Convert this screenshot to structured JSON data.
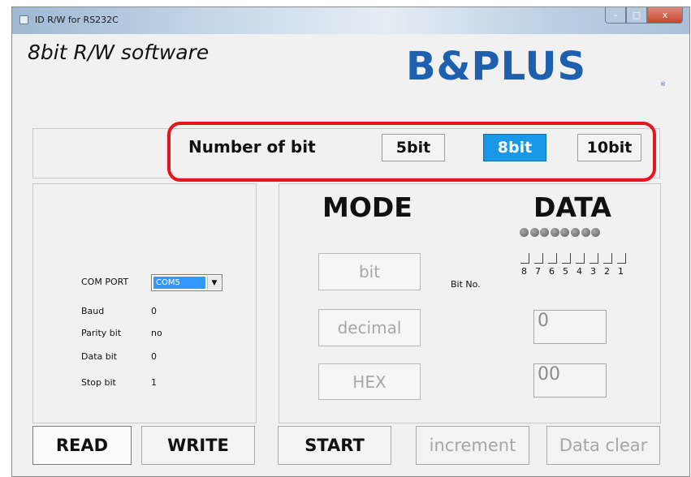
{
  "window": {
    "title": "ID R/W for RS232C",
    "controls": {
      "minimize": "–",
      "maximize": "□",
      "close": "x"
    }
  },
  "header": {
    "title": "8bit R/W software",
    "logo_text": "B&PLUS",
    "logo_mark": "®",
    "brand_color": "#1e5fae"
  },
  "bit_select": {
    "label": "Number of bit",
    "options": [
      "5bit",
      "8bit",
      "10bit"
    ],
    "selected": "8bit",
    "highlight_color": "#e8141c"
  },
  "mode_section": {
    "title": "MODE",
    "buttons": [
      "bit",
      "decimal",
      "HEX"
    ]
  },
  "data_section": {
    "title": "DATA",
    "bit_no_label": "Bit No.",
    "bit_numbers": [
      "8",
      "7",
      "6",
      "5",
      "4",
      "3",
      "2",
      "1"
    ],
    "indicator_count": 8,
    "decimal_value": "0",
    "hex_value": "00"
  },
  "com_settings": {
    "com_port_label": "COM PORT",
    "com_port_value": "COM5",
    "rows": [
      {
        "label": "Baud",
        "value": "0"
      },
      {
        "label": "Parity bit",
        "value": "no"
      },
      {
        "label": "Data bit",
        "value": "0"
      },
      {
        "label": "Stop bit",
        "value": "1"
      }
    ]
  },
  "bottom_bar": {
    "read": "READ",
    "write": "WRITE",
    "start": "START",
    "increment": "increment",
    "data_clear": "Data clear"
  }
}
